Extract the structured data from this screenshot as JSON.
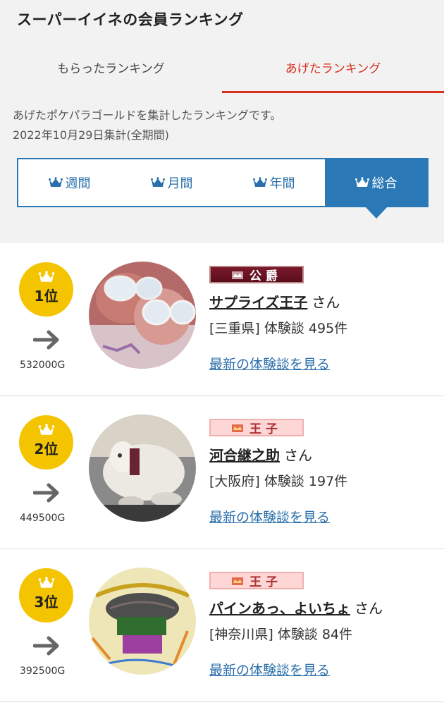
{
  "page": {
    "title": "スーパーイイネの会員ランキング",
    "tabs": [
      {
        "label": "もらったランキング",
        "active": false
      },
      {
        "label": "あげたランキング",
        "active": true
      }
    ],
    "description_line1": "あげたポケパラゴールドを集計したランキングです。",
    "description_line2": "2022年10月29日集計(全期間)",
    "accent_color": "#d7301f",
    "period_tabs": [
      {
        "label": "週間",
        "active": false
      },
      {
        "label": "月間",
        "active": false
      },
      {
        "label": "年間",
        "active": false
      },
      {
        "label": "総合",
        "active": true
      }
    ]
  },
  "ranking": [
    {
      "rank_label": "1位",
      "gold": "532000G",
      "title_badge": "公爵",
      "name": "サプライズ王子",
      "honorific": "さん",
      "info": "[三重県] 体験談 495件",
      "link_text": "最新の体験談を見る"
    },
    {
      "rank_label": "2位",
      "gold": "449500G",
      "title_badge": "王子",
      "name": "河合継之助",
      "honorific": "さん",
      "info": "[大阪府] 体験談 197件",
      "link_text": "最新の体験談を見る"
    },
    {
      "rank_label": "3位",
      "gold": "392500G",
      "title_badge": "王子",
      "name": "パインあっ、よいちょ",
      "honorific": "さん",
      "info": "[神奈川県] 体験談 84件",
      "link_text": "最新の体験談を見る"
    }
  ]
}
